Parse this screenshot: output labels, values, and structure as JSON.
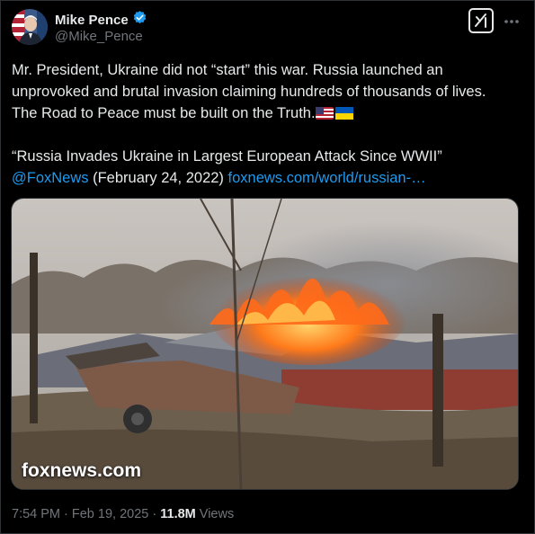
{
  "author": {
    "name": "Mike Pence",
    "handle": "@Mike_Pence"
  },
  "post": {
    "line1": "Mr. President, Ukraine did not “start” this war. Russia launched an",
    "line2": "unprovoked and brutal invasion claiming hundreds of thousands of lives.",
    "line3": "The Road to Peace must be built on the Truth.",
    "quote": "“Russia Invades Ukraine in Largest European Attack Since WWII”",
    "mention": "@FoxNews",
    "date_text": " (February 24, 2022) ",
    "link": "foxnews.com/world/russian-…"
  },
  "media": {
    "watermark": "foxnews.com"
  },
  "meta": {
    "time": "7:54 PM",
    "separator": " · ",
    "date": "Feb 19, 2025",
    "separator2": " · ",
    "views_count": "11.8M",
    "views_label": " Views"
  },
  "colors": {
    "background": "#000000",
    "text": "#e7e9ea",
    "secondary": "#71767b",
    "link": "#1d9bf0",
    "verified": "#1d9bf0"
  },
  "icons": [
    "verified-badge-icon",
    "grok-icon",
    "more-icon",
    "us-flag-emoji",
    "ukraine-flag-emoji"
  ]
}
